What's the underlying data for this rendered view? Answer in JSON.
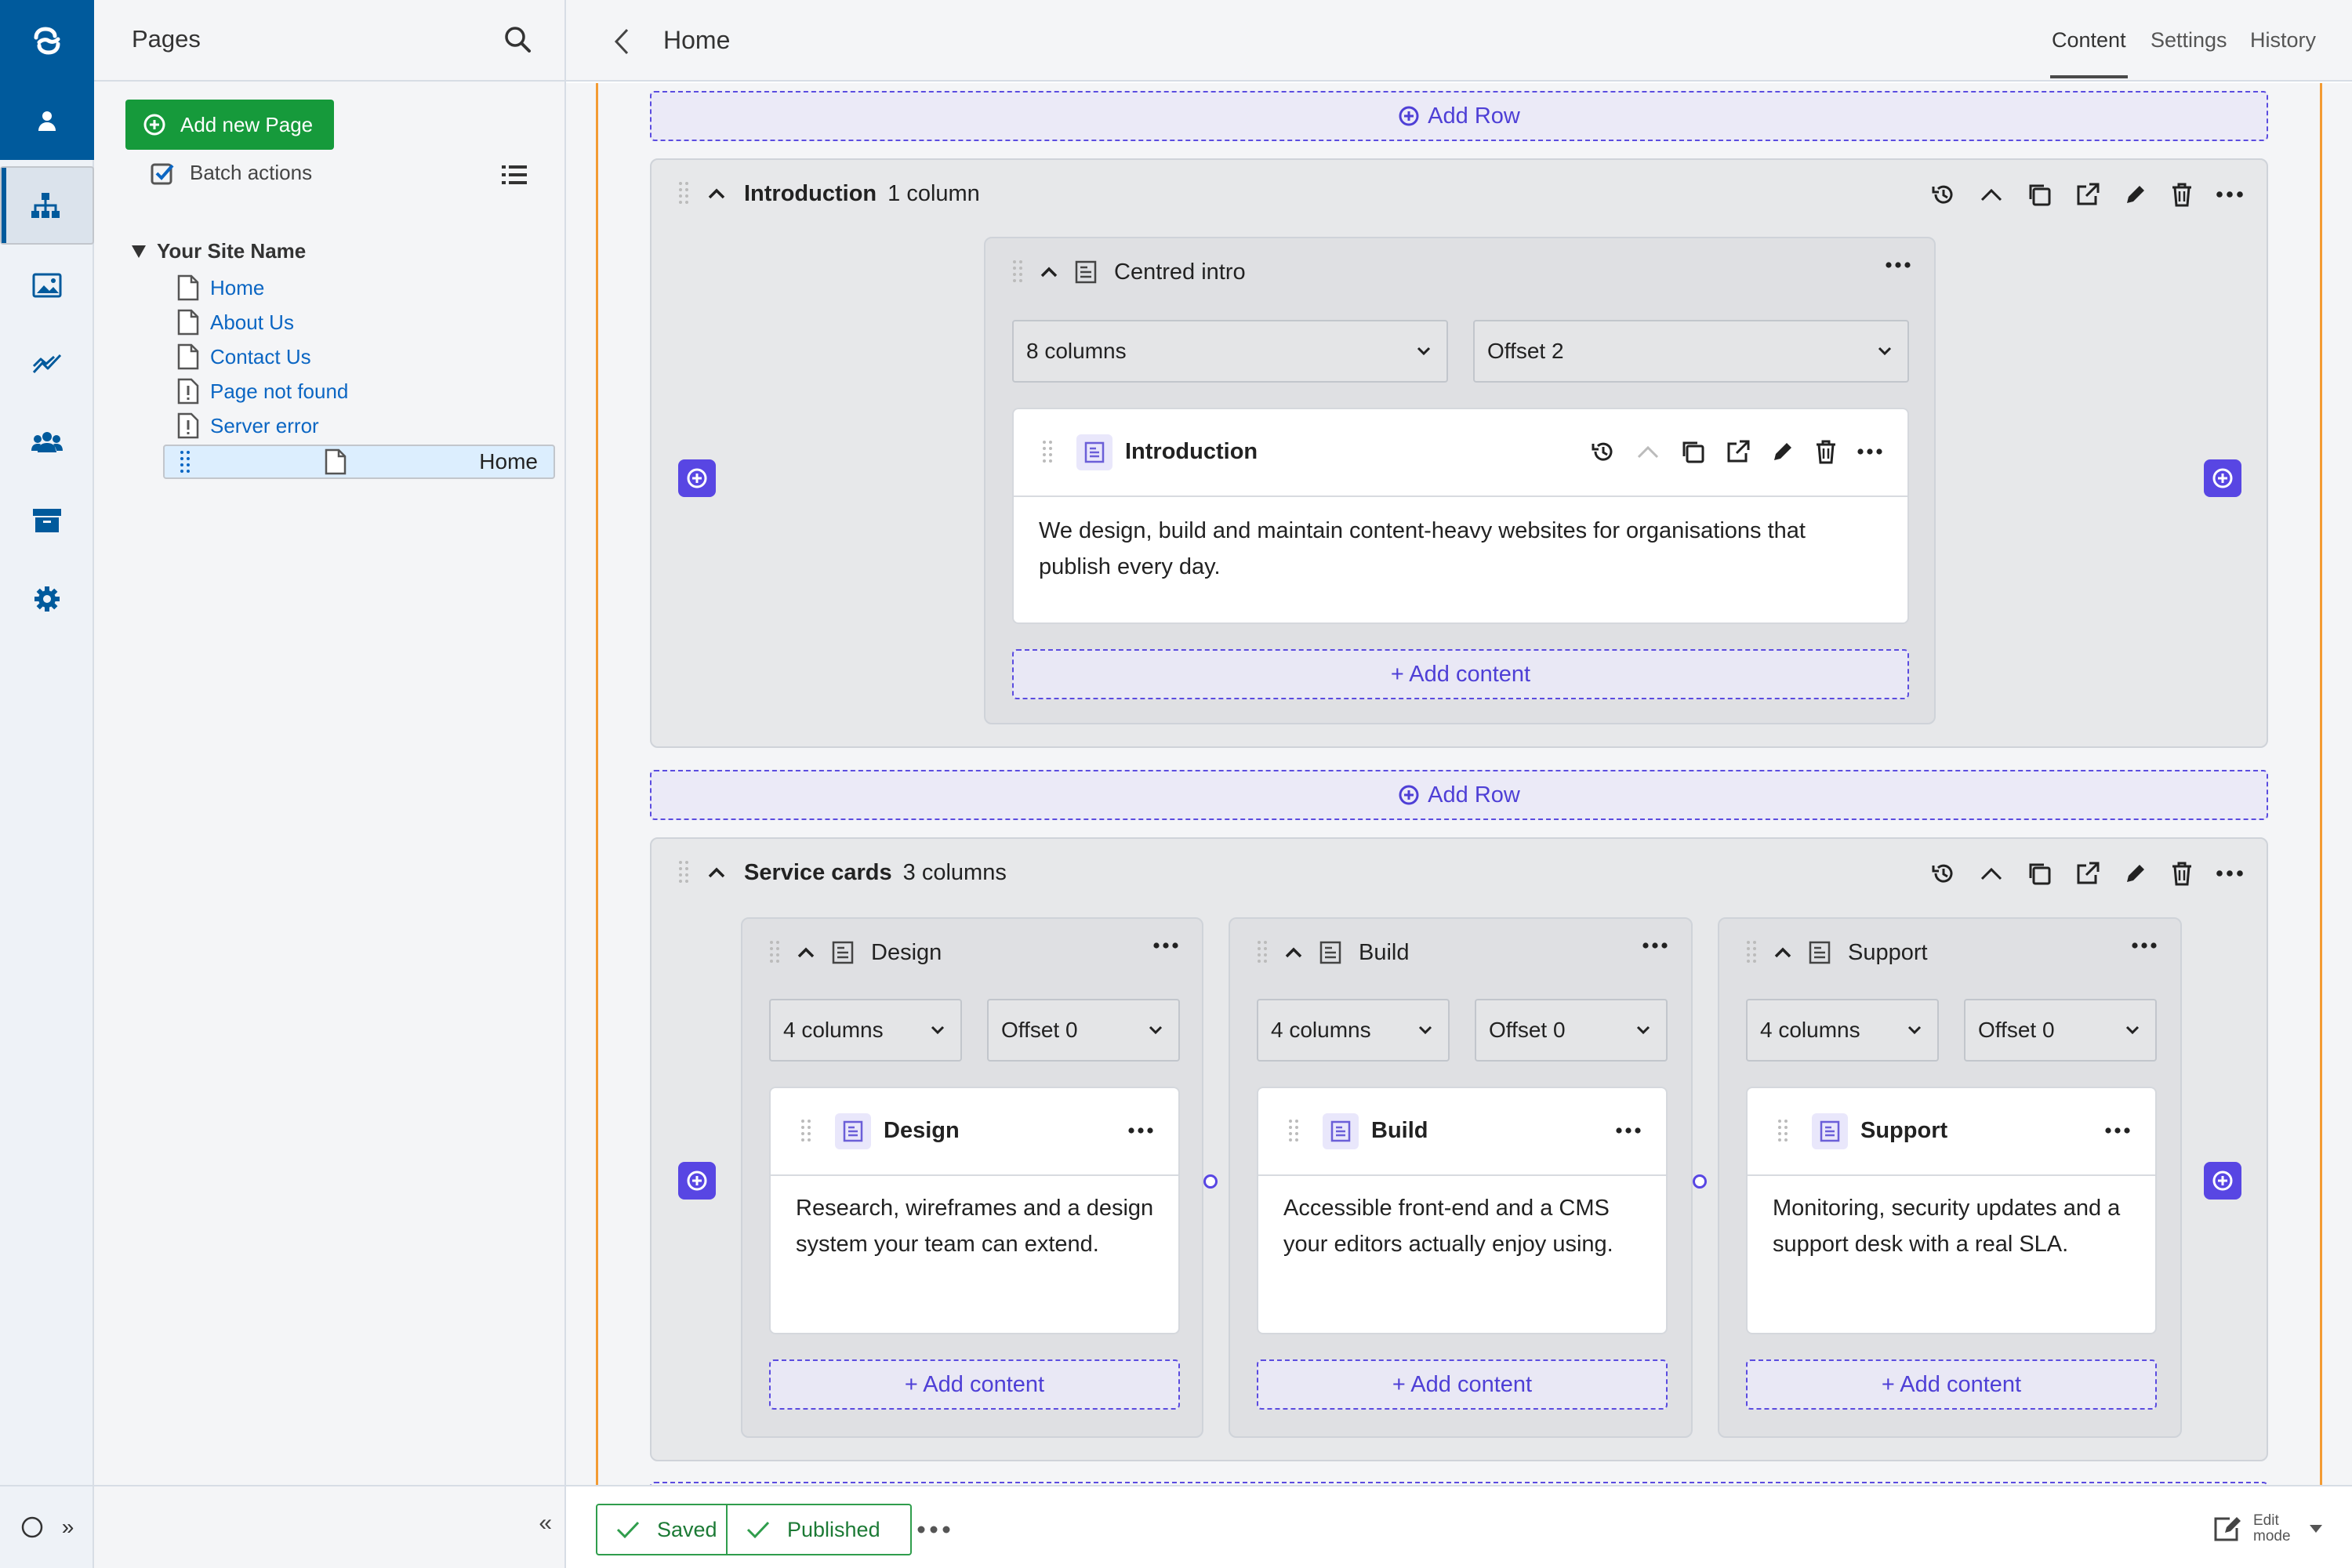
{
  "tree": {
    "title": "Pages",
    "add_page": "Add new Page",
    "batch_actions": "Batch actions",
    "site_name": "Your Site Name",
    "nodes": [
      {
        "label": "Home",
        "type": "page"
      },
      {
        "label": "About Us",
        "type": "page"
      },
      {
        "label": "Contact Us",
        "type": "page"
      },
      {
        "label": "Page not found",
        "type": "error"
      },
      {
        "label": "Server error",
        "type": "error"
      },
      {
        "label": "Home",
        "type": "page",
        "selected": true
      }
    ]
  },
  "topbar": {
    "title": "Home",
    "tabs": [
      "Content",
      "Settings",
      "History"
    ],
    "active_tab": "Content"
  },
  "editor": {
    "add_row": "Add Row",
    "rows": [
      {
        "title": "Introduction",
        "subtitle": "1 column",
        "columns": [
          {
            "title": "Centred intro",
            "width": "8 columns",
            "offset": "Offset 2",
            "block_title": "Introduction",
            "text": "We design, build and maintain content-heavy websites for organisations that publish every day.",
            "add_content": "+ Add content"
          }
        ]
      },
      {
        "title": "Service cards",
        "subtitle": "3 columns",
        "columns": [
          {
            "title": "Design",
            "width": "4 columns",
            "offset": "Offset 0",
            "block_title": "Design",
            "text": "Research, wireframes and a design system your team can extend.",
            "add_content": "+ Add content"
          },
          {
            "title": "Build",
            "width": "4 columns",
            "offset": "Offset 0",
            "block_title": "Build",
            "text": "Accessible front-end and a CMS your editors actually enjoy using.",
            "add_content": "+ Add content"
          },
          {
            "title": "Support",
            "width": "4 columns",
            "offset": "Offset 0",
            "block_title": "Support",
            "text": "Monitoring, security updates and a support desk with a real SLA.",
            "add_content": "+ Add content"
          }
        ]
      }
    ]
  },
  "footer": {
    "saved": "Saved",
    "published": "Published",
    "edit_mode": "Edit mode"
  },
  "colors": {
    "brand": "#005a9c",
    "add_page": "#169a3b",
    "accent": "#5846e3",
    "link": "#0b66c3",
    "status_green": "#1c7a35",
    "preview_edge": "#f39b33"
  }
}
